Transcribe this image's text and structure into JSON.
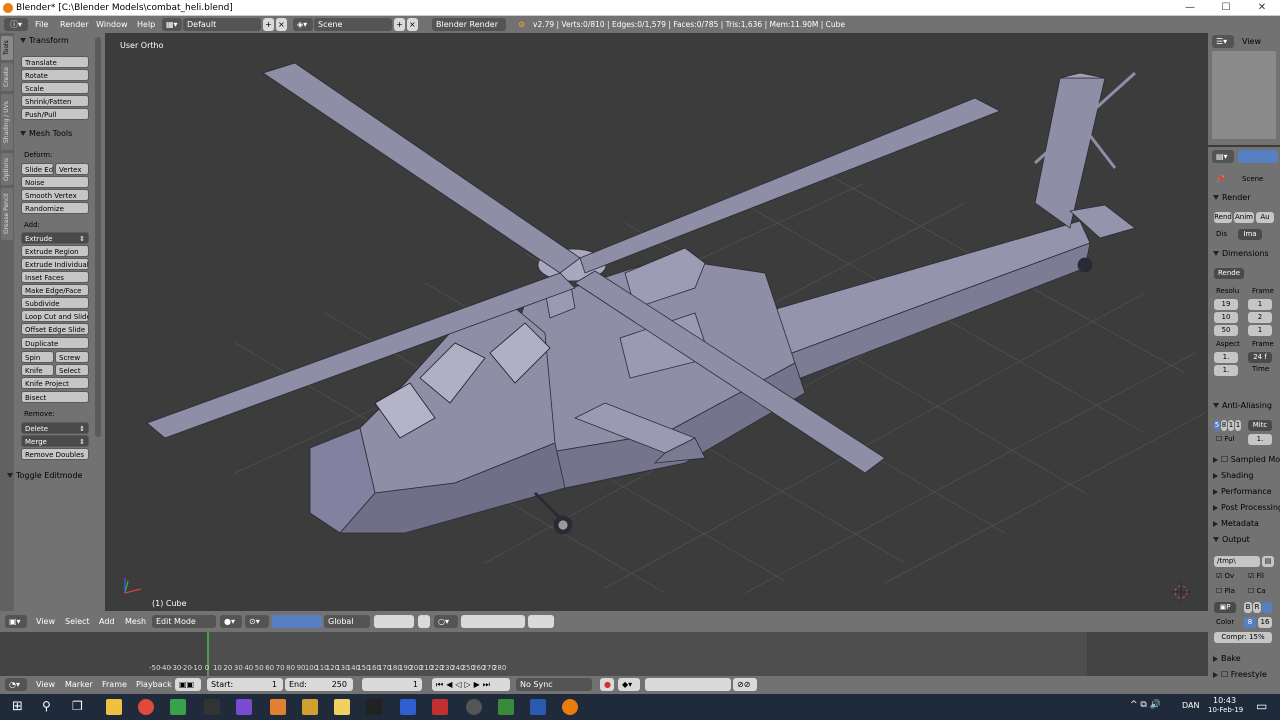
{
  "window": {
    "title": "Blender* [C:\\Blender Models\\combat_heli.blend]",
    "minimize": "—",
    "maximize": "☐",
    "close": "✕"
  },
  "info_header": {
    "menus": [
      "File",
      "Render",
      "Window",
      "Help"
    ],
    "layout": "Default",
    "scene": "Scene",
    "engine": "Blender Render",
    "stats": "v2.79 | Verts:0/810 | Edges:0/1,579 | Faces:0/785 | Tris:1,636 | Mem:11.90M | Cube"
  },
  "tool_shelf": {
    "tabs": [
      "Tools",
      "Create",
      "Shading / UVs",
      "Options",
      "Grease Pencil"
    ],
    "transform": {
      "title": "Transform",
      "buttons": [
        "Translate",
        "Rotate",
        "Scale",
        "Shrink/Fatten",
        "Push/Pull"
      ]
    },
    "mesh_tools": {
      "title": "Mesh Tools",
      "deform_label": "Deform:",
      "slide_edge": "Slide Ed",
      "vertex": "Vertex",
      "noise": "Noise",
      "smooth_vertex": "Smooth Vertex",
      "randomize": "Randomize",
      "add_label": "Add:",
      "extrude": "Extrude",
      "add_buttons": [
        "Extrude Region",
        "Extrude Individual",
        "Inset Faces",
        "Make Edge/Face",
        "Subdivide",
        "Loop Cut and Slide",
        "Offset Edge Slide",
        "Duplicate"
      ],
      "spin": "Spin",
      "screw": "Screw",
      "knife": "Knife",
      "select": "Select",
      "knife_project": "Knife Project",
      "bisect": "Bisect",
      "remove_label": "Remove:",
      "delete": "Delete",
      "merge": "Merge",
      "remove_doubles": "Remove Doubles"
    },
    "toggle_editmode": "Toggle Editmode"
  },
  "viewport": {
    "view_label": "User Ortho",
    "object_label": "(1) Cube"
  },
  "view3d_header": {
    "menus": [
      "View",
      "Select",
      "Add",
      "Mesh"
    ],
    "mode": "Edit Mode",
    "orientation": "Global"
  },
  "timeline": {
    "ticks": [
      "-50",
      "-40",
      "-30",
      "-20",
      "-10",
      "0",
      "10",
      "20",
      "30",
      "40",
      "50",
      "60",
      "70",
      "80",
      "90",
      "100",
      "110",
      "120",
      "130",
      "140",
      "150",
      "160",
      "170",
      "180",
      "190",
      "200",
      "210",
      "220",
      "230",
      "240",
      "250",
      "260",
      "270",
      "280"
    ],
    "menus": [
      "View",
      "Marker",
      "Frame",
      "Playback"
    ],
    "start_label": "Start:",
    "start_value": "1",
    "end_label": "End:",
    "end_value": "250",
    "current_frame": "1",
    "sync": "No Sync"
  },
  "outliner": {
    "view": "View"
  },
  "properties": {
    "scene_label": "Scene",
    "render_panel": "Render",
    "render_btns": [
      "Rend",
      "Anim",
      "Au"
    ],
    "display_label": "Dis",
    "display_value": "Ima",
    "dimensions_panel": "Dimensions",
    "render_preset": "Rende",
    "resolution_label": "Resolu",
    "frame_label": "Frame",
    "res_x": "19",
    "res_y": "10",
    "res_pct": "50",
    "frame_start": "1",
    "frame_end": "2",
    "frame_step": "1",
    "aspect_label": "Aspect",
    "frame_rate_label": "Frame",
    "aspect_x": "1.",
    "fps": "24 f",
    "aspect_y": "1.",
    "time_label": "Time",
    "anti_alias_panel": "Anti-Aliasing",
    "aa_samples": [
      "5",
      "8",
      "1",
      "1"
    ],
    "aa_filter": "Mitc",
    "full_sample": "Ful",
    "aa_size": "1.",
    "collapsed_panels": [
      "Sampled Motion Blur",
      "Shading",
      "Performance",
      "Post Processing",
      "Metadata"
    ],
    "output_panel": "Output",
    "output_path": "/tmp\\",
    "overwrite": "Ov",
    "file_ext": "Fil",
    "placeholders": "Pla",
    "cache_result": "Ca",
    "format_btns": [
      "B",
      "R"
    ],
    "color_label": "Color",
    "color_depth": [
      "8",
      "16"
    ],
    "compression": "Compr: 15%",
    "bake_panel": "Bake",
    "freestyle_panel": "Freestyle"
  },
  "taskbar": {
    "tray_lang": "DAN",
    "time": "10:43",
    "date": "10-Feb-19"
  },
  "colors": {
    "header": "#727272",
    "viewport_bg": "#3c3c3c",
    "mesh": "#8e8ea6",
    "mesh_dark": "#6d6d86",
    "timeline_bg": "#4e4e4e",
    "current_frame": "#4d9f44",
    "taskbar": "#1f2b3a"
  }
}
